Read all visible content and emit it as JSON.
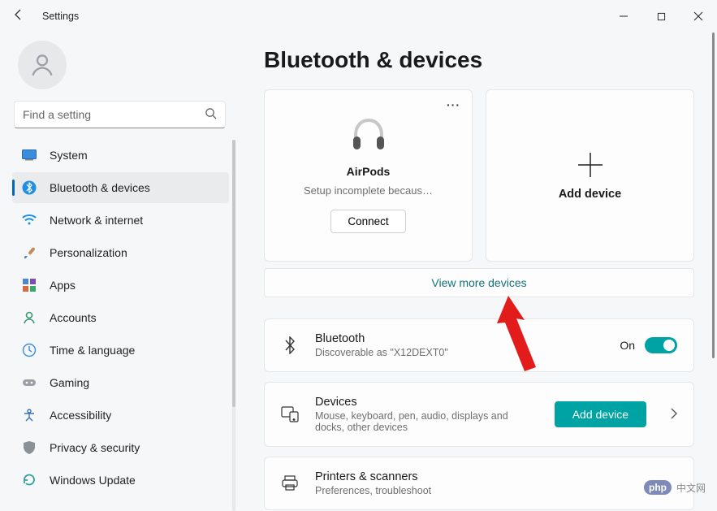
{
  "window": {
    "title": "Settings"
  },
  "search": {
    "placeholder": "Find a setting"
  },
  "nav": {
    "active_index": 1,
    "items": [
      {
        "label": "System"
      },
      {
        "label": "Bluetooth & devices"
      },
      {
        "label": "Network & internet"
      },
      {
        "label": "Personalization"
      },
      {
        "label": "Apps"
      },
      {
        "label": "Accounts"
      },
      {
        "label": "Time & language"
      },
      {
        "label": "Gaming"
      },
      {
        "label": "Accessibility"
      },
      {
        "label": "Privacy & security"
      },
      {
        "label": "Windows Update"
      }
    ]
  },
  "page": {
    "title": "Bluetooth & devices",
    "device_card": {
      "name": "AirPods",
      "status": "Setup incomplete becaus…",
      "action": "Connect"
    },
    "add_card": {
      "label": "Add device"
    },
    "view_more": "View more devices",
    "bluetooth": {
      "title": "Bluetooth",
      "subtitle": "Discoverable as \"X12DEXT0\"",
      "state_label": "On",
      "on": true
    },
    "devices": {
      "title": "Devices",
      "subtitle": "Mouse, keyboard, pen, audio, displays and docks, other devices",
      "action": "Add device"
    },
    "printers": {
      "title": "Printers & scanners",
      "subtitle": "Preferences, troubleshoot"
    }
  },
  "watermark": {
    "badge": "php",
    "text": "中文网"
  },
  "colors": {
    "accent": "#00a3a3",
    "link": "#14737b",
    "nav_marker": "#0067c0"
  }
}
